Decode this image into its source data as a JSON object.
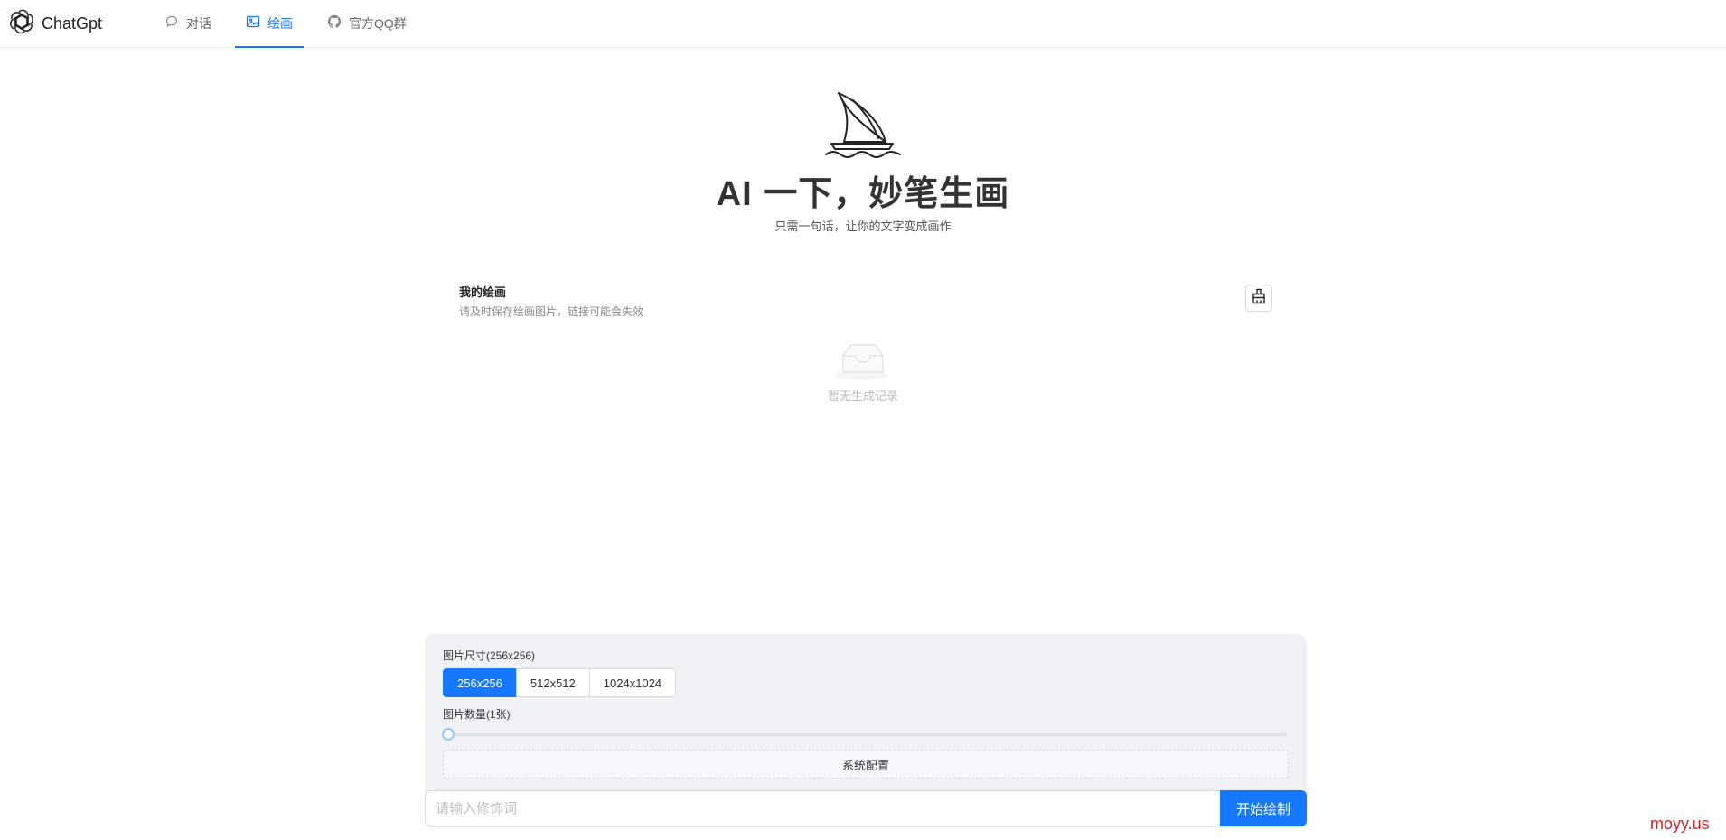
{
  "app": {
    "name": "ChatGpt",
    "logo_icon": "openai-logo-icon"
  },
  "nav": {
    "items": [
      {
        "label": "对话",
        "icon": "chat-bubble-icon",
        "active": false
      },
      {
        "label": "绘画",
        "icon": "image-icon",
        "active": true
      },
      {
        "label": "官方QQ群",
        "icon": "github-icon",
        "active": false
      }
    ],
    "accent_color": "#1677ff"
  },
  "hero": {
    "icon": "sailboat-icon",
    "title": "AI 一下，妙笔生画",
    "subtitle": "只需一句话，让你的文字变成画作"
  },
  "history": {
    "title": "我的绘画",
    "subtitle": "请及时保存绘画图片，链接可能会失效",
    "clear_icon": "broom-icon",
    "empty_icon": "empty-inbox-icon",
    "empty_text": "暂无生成记录"
  },
  "settings": {
    "size_label": "图片尺寸(256x256)",
    "sizes": [
      "256x256",
      "512x512",
      "1024x1024"
    ],
    "selected_size": "256x256",
    "count_label": "图片数量(1张)",
    "count_value": 1,
    "config_label": "系统配置"
  },
  "prompt": {
    "placeholder": "请输入修饰词",
    "value": "",
    "submit_label": "开始绘制"
  },
  "watermark": "moyy.us"
}
